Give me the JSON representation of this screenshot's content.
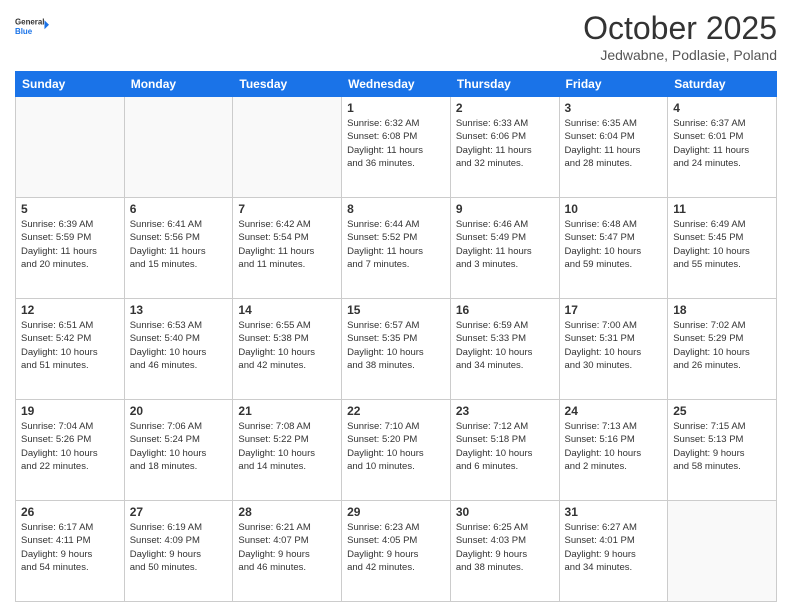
{
  "logo": {
    "line1": "General",
    "line2": "Blue"
  },
  "title": "October 2025",
  "subtitle": "Jedwabne, Podlasie, Poland",
  "weekdays": [
    "Sunday",
    "Monday",
    "Tuesday",
    "Wednesday",
    "Thursday",
    "Friday",
    "Saturday"
  ],
  "weeks": [
    [
      {
        "day": "",
        "info": ""
      },
      {
        "day": "",
        "info": ""
      },
      {
        "day": "",
        "info": ""
      },
      {
        "day": "1",
        "info": "Sunrise: 6:32 AM\nSunset: 6:08 PM\nDaylight: 11 hours\nand 36 minutes."
      },
      {
        "day": "2",
        "info": "Sunrise: 6:33 AM\nSunset: 6:06 PM\nDaylight: 11 hours\nand 32 minutes."
      },
      {
        "day": "3",
        "info": "Sunrise: 6:35 AM\nSunset: 6:04 PM\nDaylight: 11 hours\nand 28 minutes."
      },
      {
        "day": "4",
        "info": "Sunrise: 6:37 AM\nSunset: 6:01 PM\nDaylight: 11 hours\nand 24 minutes."
      }
    ],
    [
      {
        "day": "5",
        "info": "Sunrise: 6:39 AM\nSunset: 5:59 PM\nDaylight: 11 hours\nand 20 minutes."
      },
      {
        "day": "6",
        "info": "Sunrise: 6:41 AM\nSunset: 5:56 PM\nDaylight: 11 hours\nand 15 minutes."
      },
      {
        "day": "7",
        "info": "Sunrise: 6:42 AM\nSunset: 5:54 PM\nDaylight: 11 hours\nand 11 minutes."
      },
      {
        "day": "8",
        "info": "Sunrise: 6:44 AM\nSunset: 5:52 PM\nDaylight: 11 hours\nand 7 minutes."
      },
      {
        "day": "9",
        "info": "Sunrise: 6:46 AM\nSunset: 5:49 PM\nDaylight: 11 hours\nand 3 minutes."
      },
      {
        "day": "10",
        "info": "Sunrise: 6:48 AM\nSunset: 5:47 PM\nDaylight: 10 hours\nand 59 minutes."
      },
      {
        "day": "11",
        "info": "Sunrise: 6:49 AM\nSunset: 5:45 PM\nDaylight: 10 hours\nand 55 minutes."
      }
    ],
    [
      {
        "day": "12",
        "info": "Sunrise: 6:51 AM\nSunset: 5:42 PM\nDaylight: 10 hours\nand 51 minutes."
      },
      {
        "day": "13",
        "info": "Sunrise: 6:53 AM\nSunset: 5:40 PM\nDaylight: 10 hours\nand 46 minutes."
      },
      {
        "day": "14",
        "info": "Sunrise: 6:55 AM\nSunset: 5:38 PM\nDaylight: 10 hours\nand 42 minutes."
      },
      {
        "day": "15",
        "info": "Sunrise: 6:57 AM\nSunset: 5:35 PM\nDaylight: 10 hours\nand 38 minutes."
      },
      {
        "day": "16",
        "info": "Sunrise: 6:59 AM\nSunset: 5:33 PM\nDaylight: 10 hours\nand 34 minutes."
      },
      {
        "day": "17",
        "info": "Sunrise: 7:00 AM\nSunset: 5:31 PM\nDaylight: 10 hours\nand 30 minutes."
      },
      {
        "day": "18",
        "info": "Sunrise: 7:02 AM\nSunset: 5:29 PM\nDaylight: 10 hours\nand 26 minutes."
      }
    ],
    [
      {
        "day": "19",
        "info": "Sunrise: 7:04 AM\nSunset: 5:26 PM\nDaylight: 10 hours\nand 22 minutes."
      },
      {
        "day": "20",
        "info": "Sunrise: 7:06 AM\nSunset: 5:24 PM\nDaylight: 10 hours\nand 18 minutes."
      },
      {
        "day": "21",
        "info": "Sunrise: 7:08 AM\nSunset: 5:22 PM\nDaylight: 10 hours\nand 14 minutes."
      },
      {
        "day": "22",
        "info": "Sunrise: 7:10 AM\nSunset: 5:20 PM\nDaylight: 10 hours\nand 10 minutes."
      },
      {
        "day": "23",
        "info": "Sunrise: 7:12 AM\nSunset: 5:18 PM\nDaylight: 10 hours\nand 6 minutes."
      },
      {
        "day": "24",
        "info": "Sunrise: 7:13 AM\nSunset: 5:16 PM\nDaylight: 10 hours\nand 2 minutes."
      },
      {
        "day": "25",
        "info": "Sunrise: 7:15 AM\nSunset: 5:13 PM\nDaylight: 9 hours\nand 58 minutes."
      }
    ],
    [
      {
        "day": "26",
        "info": "Sunrise: 6:17 AM\nSunset: 4:11 PM\nDaylight: 9 hours\nand 54 minutes."
      },
      {
        "day": "27",
        "info": "Sunrise: 6:19 AM\nSunset: 4:09 PM\nDaylight: 9 hours\nand 50 minutes."
      },
      {
        "day": "28",
        "info": "Sunrise: 6:21 AM\nSunset: 4:07 PM\nDaylight: 9 hours\nand 46 minutes."
      },
      {
        "day": "29",
        "info": "Sunrise: 6:23 AM\nSunset: 4:05 PM\nDaylight: 9 hours\nand 42 minutes."
      },
      {
        "day": "30",
        "info": "Sunrise: 6:25 AM\nSunset: 4:03 PM\nDaylight: 9 hours\nand 38 minutes."
      },
      {
        "day": "31",
        "info": "Sunrise: 6:27 AM\nSunset: 4:01 PM\nDaylight: 9 hours\nand 34 minutes."
      },
      {
        "day": "",
        "info": ""
      }
    ]
  ]
}
